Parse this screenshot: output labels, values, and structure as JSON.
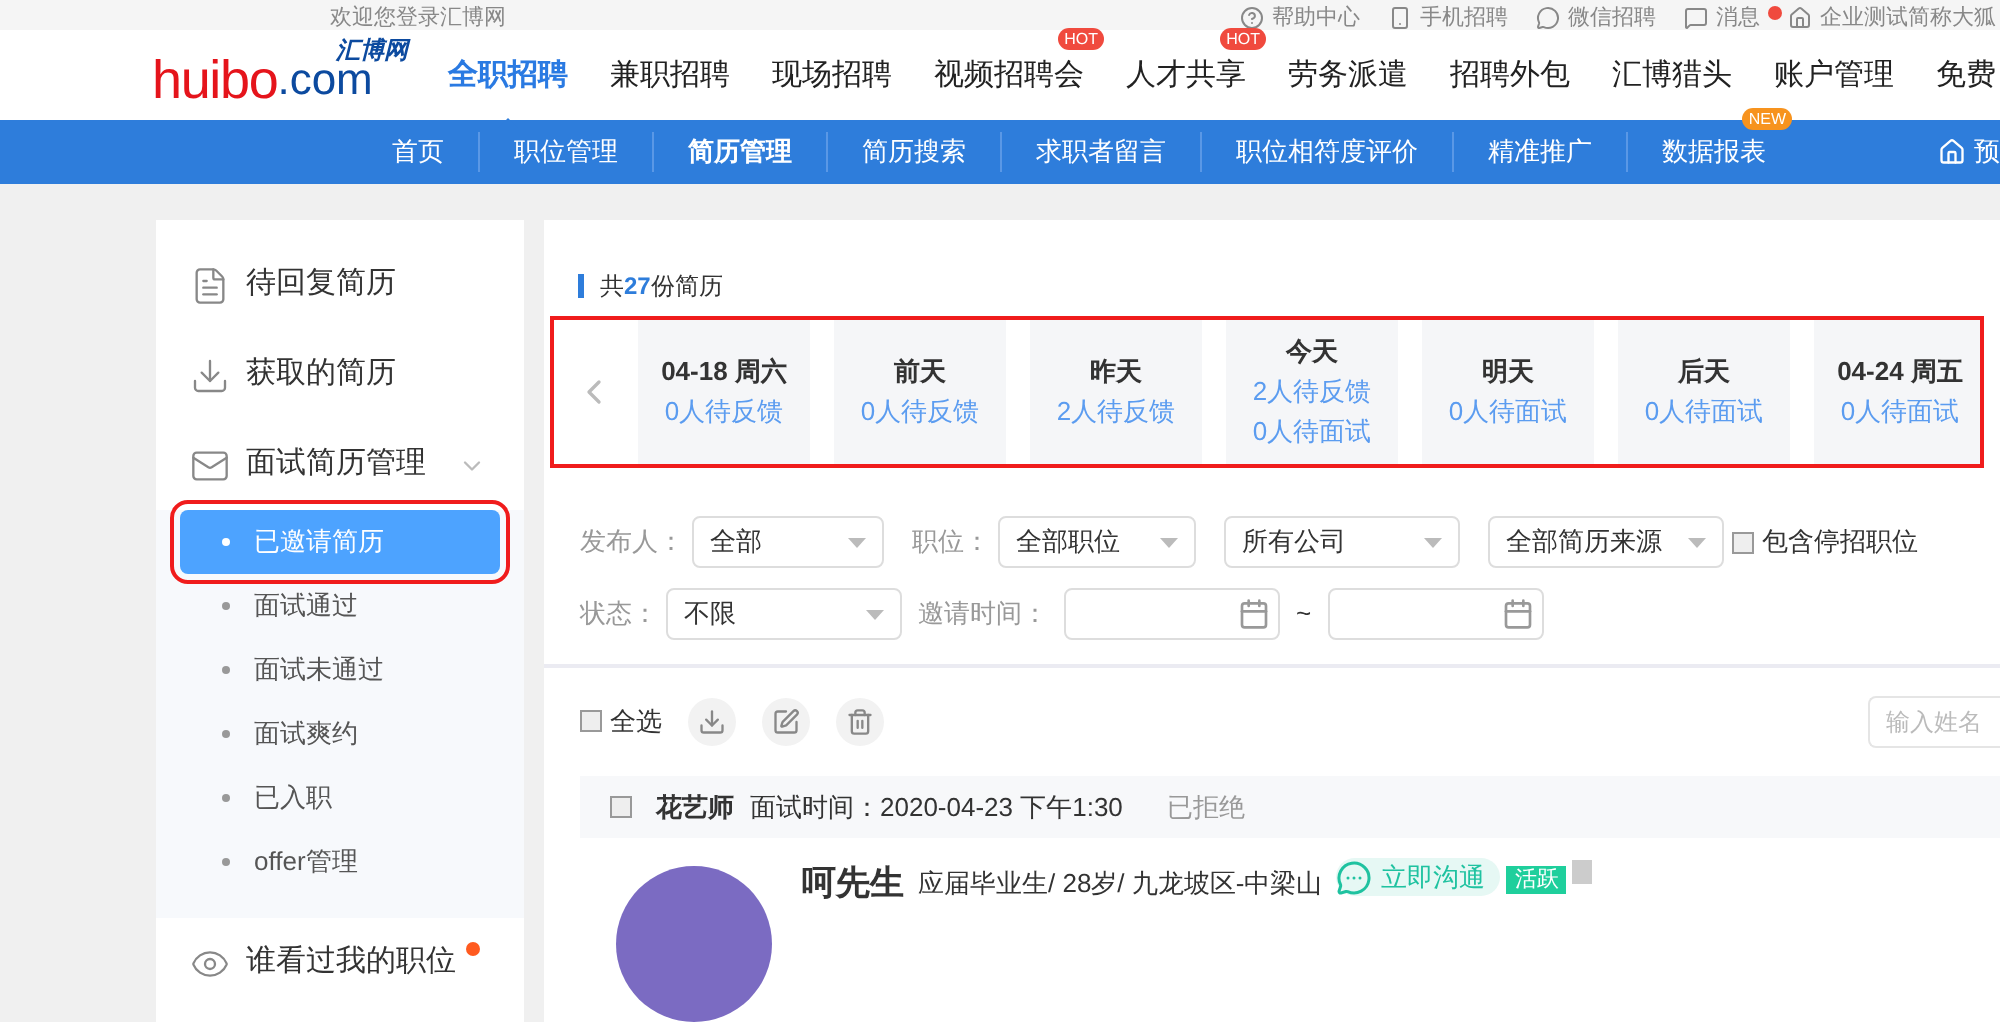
{
  "top_bar": {
    "welcome": "欢迎您登录汇博网",
    "links": [
      {
        "label": "帮助中心",
        "kind": "help"
      },
      {
        "label": "手机招聘",
        "kind": "phone"
      },
      {
        "label": "微信招聘",
        "kind": "chat"
      },
      {
        "label": "消息",
        "kind": "message",
        "badge": true
      },
      {
        "label": "企业测试简称大狐",
        "kind": "home"
      }
    ]
  },
  "logo": {
    "text": "huibo",
    "suffix": ".com",
    "chinese": "汇博网"
  },
  "main_nav": [
    {
      "label": "全职招聘",
      "selected": true
    },
    {
      "label": "兼职招聘",
      "selected": false
    },
    {
      "label": "现场招聘",
      "selected": false
    },
    {
      "label": "视频招聘会",
      "selected": false,
      "badge": "HOT"
    },
    {
      "label": "人才共享",
      "selected": false,
      "badge": "HOT"
    },
    {
      "label": "劳务派遣",
      "selected": false
    },
    {
      "label": "招聘外包",
      "selected": false
    },
    {
      "label": "汇博猎头",
      "selected": false
    },
    {
      "label": "账户管理",
      "selected": false
    },
    {
      "label": "免费",
      "selected": false
    }
  ],
  "sub_nav": [
    {
      "label": "首页",
      "selected": false
    },
    {
      "label": "职位管理",
      "selected": false
    },
    {
      "label": "简历管理",
      "selected": true
    },
    {
      "label": "简历搜索",
      "selected": false
    },
    {
      "label": "求职者留言",
      "selected": false
    },
    {
      "label": "职位相符度评价",
      "selected": false
    },
    {
      "label": "精准推广",
      "selected": false
    },
    {
      "label": "数据报表",
      "selected": false,
      "badge": "NEW"
    }
  ],
  "sub_nav_right": "预",
  "sidebar": {
    "items": [
      {
        "label": "待回复简历",
        "kind": "reply",
        "dot": false
      },
      {
        "label": "获取的简历",
        "kind": "download",
        "dot": false
      },
      {
        "label": "面试简历管理",
        "kind": "mail",
        "expanded": true,
        "dot": false,
        "children": [
          {
            "label": "已邀请简历",
            "selected": true
          },
          {
            "label": "面试通过",
            "selected": false
          },
          {
            "label": "面试未通过",
            "selected": false
          },
          {
            "label": "面试爽约",
            "selected": false
          },
          {
            "label": "已入职",
            "selected": false
          },
          {
            "label": "offer管理",
            "selected": false
          }
        ]
      },
      {
        "label": "谁看过我的职位",
        "kind": "eye",
        "dot": true
      }
    ]
  },
  "summary": {
    "prefix": "共",
    "count": "27",
    "suffix": "份简历"
  },
  "day_cards": [
    {
      "title": "04-18 周六",
      "lines": [
        "0人待反馈"
      ]
    },
    {
      "title": "前天",
      "lines": [
        "0人待反馈"
      ]
    },
    {
      "title": "昨天",
      "lines": [
        "2人待反馈"
      ]
    },
    {
      "title": "今天",
      "lines": [
        "2人待反馈",
        "0人待面试"
      ]
    },
    {
      "title": "明天",
      "lines": [
        "0人待面试"
      ]
    },
    {
      "title": "后天",
      "lines": [
        "0人待面试"
      ]
    },
    {
      "title": "04-24 周五",
      "lines": [
        "0人待面试"
      ]
    }
  ],
  "filters": {
    "row1": [
      {
        "label": "发布人：",
        "value": "全部"
      },
      {
        "label": "职位：",
        "value": "全部职位"
      },
      {
        "value": "所有公司"
      },
      {
        "value": "全部简历来源"
      }
    ],
    "include_paused": {
      "label": "包含停招职位",
      "checked": false
    },
    "status": {
      "label": "状态：",
      "value": "不限"
    },
    "invite_time": {
      "label": "邀请时间：",
      "separator": "~"
    }
  },
  "toolbar": {
    "select_all": {
      "label": "全选",
      "checked": false
    },
    "search_placeholder": "输入姓名"
  },
  "resume": {
    "checked": false,
    "position": "花艺师",
    "interview_time": "面试时间：2020-04-23 下午1:30",
    "status": "已拒绝",
    "name": "呵先生",
    "details": "应届毕业生/ 28岁/ 九龙坡区-中梁山",
    "chat": "立即沟通",
    "active": "活跃"
  }
}
